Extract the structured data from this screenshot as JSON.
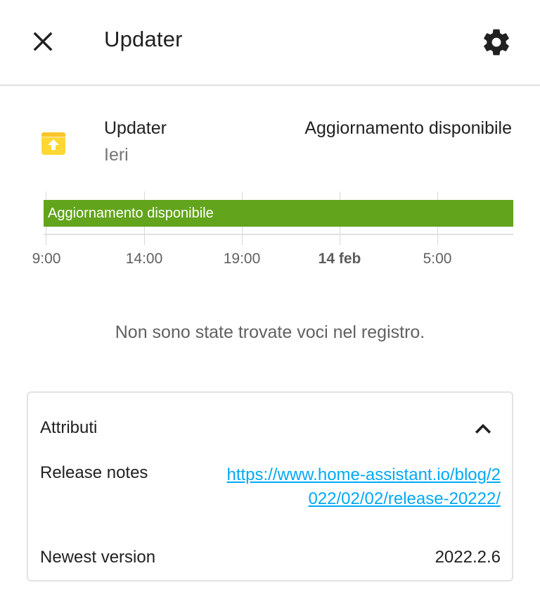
{
  "header": {
    "title": "Updater",
    "close_icon": "close-icon",
    "settings_icon": "gear-icon"
  },
  "entity": {
    "name": "Updater",
    "last_changed": "Ieri",
    "state": "Aggiornamento disponibile",
    "icon": "package-up-icon",
    "icon_color": "#fdd835"
  },
  "timeline": {
    "bar_label": "Aggiornamento disponibile",
    "bar_color": "#62a41b",
    "ticks": [
      "9:00",
      "14:00",
      "19:00",
      "14 feb",
      "5:00"
    ]
  },
  "logbook": {
    "empty_message": "Non sono state trovate voci nel registro."
  },
  "attributes": {
    "title": "Attributi",
    "collapse_icon": "chevron-up-icon",
    "items": [
      {
        "label": "Release notes",
        "value": "https://www.home-assistant.io/blog/2022/02/02/release-20222/"
      },
      {
        "label": "Newest version",
        "value": "2022.2.6"
      }
    ],
    "link_color": "#03a9f4"
  }
}
